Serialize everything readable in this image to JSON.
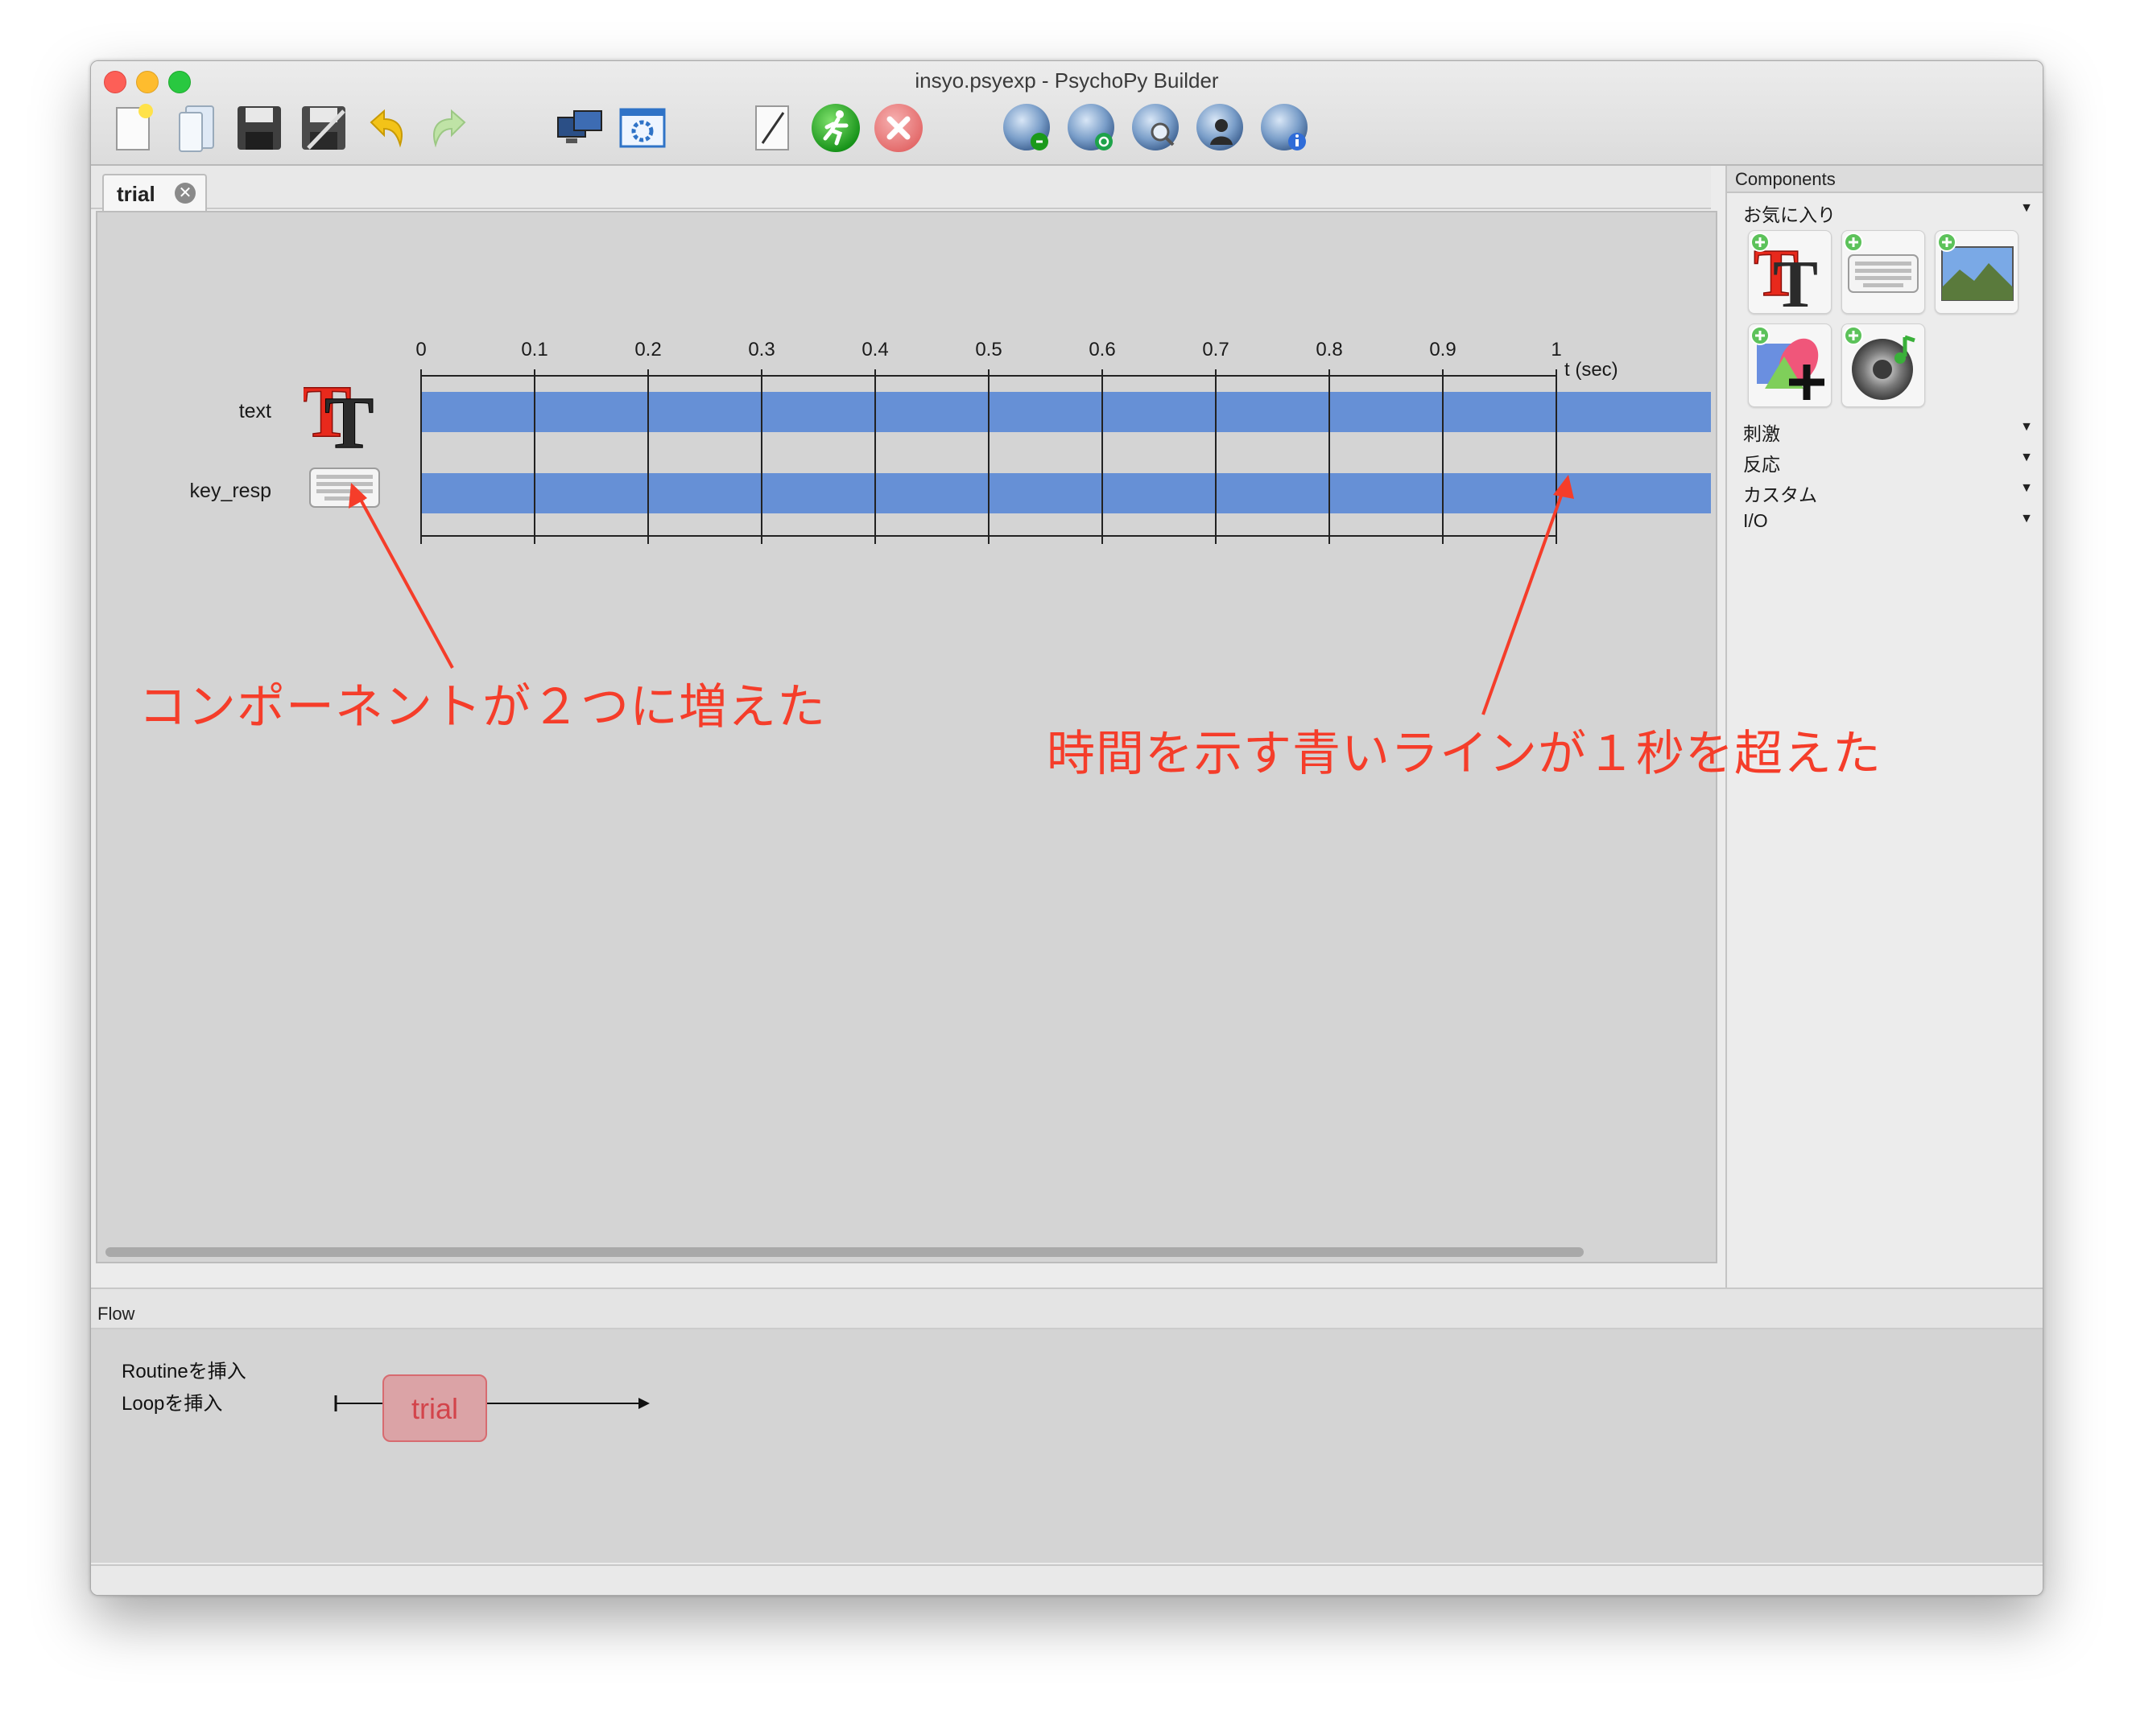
{
  "window": {
    "title": "insyo.psyexp - PsychoPy Builder"
  },
  "toolbar": {
    "buttons": [
      {
        "icon": "new-file-icon"
      },
      {
        "icon": "open-file-icon"
      },
      {
        "icon": "save-icon"
      },
      {
        "icon": "save-as-icon"
      },
      {
        "icon": "undo-icon"
      },
      {
        "icon": "redo-icon"
      },
      {
        "icon": "monitor-center-icon"
      },
      {
        "icon": "experiment-settings-icon"
      },
      {
        "icon": "compile-script-icon"
      },
      {
        "icon": "run-icon"
      },
      {
        "icon": "stop-icon"
      },
      {
        "icon": "pavlovia-sync-run-icon"
      },
      {
        "icon": "pavlovia-sync-icon"
      },
      {
        "icon": "pavlovia-search-icon"
      },
      {
        "icon": "pavlovia-user-icon"
      },
      {
        "icon": "pavlovia-info-icon"
      }
    ]
  },
  "routine": {
    "tab_label": "trial",
    "timeline": {
      "ticks": [
        "0",
        "0.1",
        "0.2",
        "0.3",
        "0.4",
        "0.5",
        "0.6",
        "0.7",
        "0.8",
        "0.9",
        "1"
      ],
      "unit_label": "t (sec)"
    },
    "components": [
      {
        "name": "text",
        "icon": "text-component-icon",
        "start": 0,
        "stop": "beyond 1"
      },
      {
        "name": "key_resp",
        "icon": "keyboard-component-icon",
        "start": 0,
        "stop": "beyond 1"
      }
    ],
    "bar_color": "#6690d6"
  },
  "components_panel": {
    "header": "Components",
    "favorites_label": "お気に入り",
    "favorites": [
      {
        "icon": "text-component-icon"
      },
      {
        "icon": "keyboard-component-icon"
      },
      {
        "icon": "image-component-icon"
      },
      {
        "icon": "polygon-component-icon"
      },
      {
        "icon": "sound-component-icon"
      }
    ],
    "categories": [
      "刺激",
      "反応",
      "カスタム",
      "I/O"
    ]
  },
  "flow": {
    "header": "Flow",
    "insert_routine": "Routineを挿入",
    "insert_loop": "Loopを挿入",
    "routines": [
      "trial"
    ]
  },
  "annotations": {
    "left": "コンポーネントが２つに増えた",
    "right": "時間を示す青いラインが１秒を超えた",
    "color": "#f53d2a"
  }
}
